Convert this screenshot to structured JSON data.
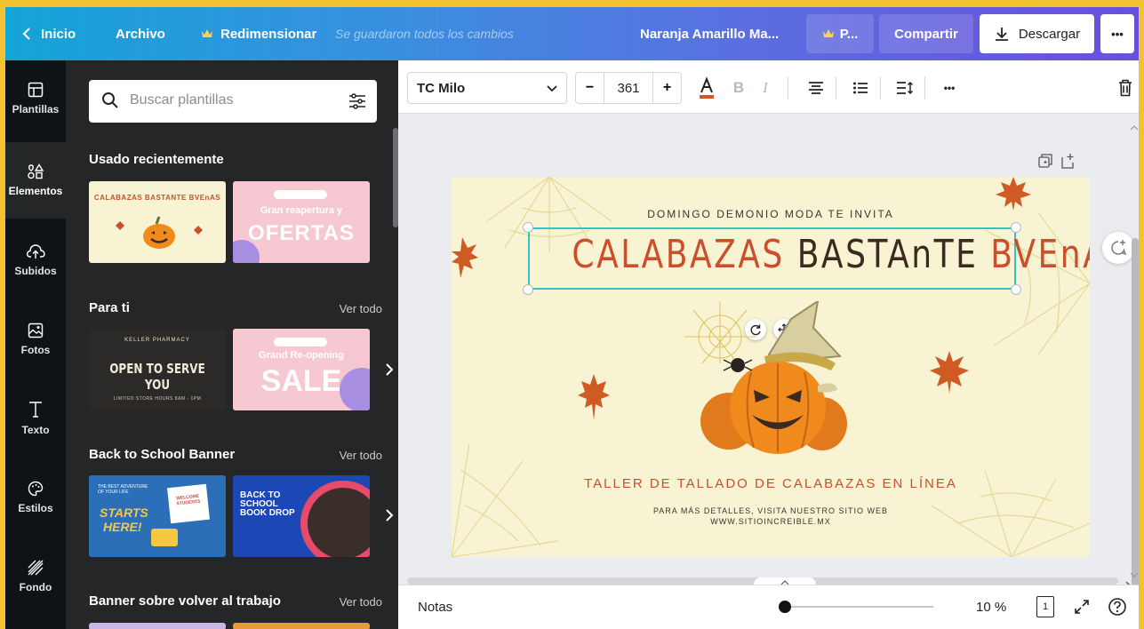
{
  "topbar": {
    "back_label": "Inicio",
    "file_label": "Archivo",
    "resize_label": "Redimensionar",
    "status_text": "Se guardaron todos los cambios",
    "doc_title": "Naranja Amarillo Ma...",
    "pro_label": "P...",
    "share_label": "Compartir",
    "download_label": "Descargar",
    "more_label": "•••"
  },
  "rail": {
    "items": [
      {
        "label": "Plantillas",
        "icon": "template-icon"
      },
      {
        "label": "Elementos",
        "icon": "elements-icon"
      },
      {
        "label": "Subidos",
        "icon": "upload-icon"
      },
      {
        "label": "Fotos",
        "icon": "photo-icon"
      },
      {
        "label": "Texto",
        "icon": "text-icon"
      },
      {
        "label": "Estilos",
        "icon": "palette-icon"
      },
      {
        "label": "Fondo",
        "icon": "background-icon"
      }
    ]
  },
  "panel": {
    "search_placeholder": "Buscar plantillas",
    "sections": [
      {
        "title": "Usado recientemente",
        "see_all": ""
      },
      {
        "title": "Para ti",
        "see_all": "Ver todo"
      },
      {
        "title": "Back to School Banner",
        "see_all": "Ver todo"
      },
      {
        "title": "Banner sobre volver al trabajo",
        "see_all": "Ver todo"
      }
    ],
    "thumbs": {
      "recent1_text": "CALABAZAS BASTANTE BVEnAS",
      "recent2_line1": "Gran reapertura y",
      "recent2_line2": "OFERTAS",
      "foryou1_top": "KELLER PHARMACY",
      "foryou1_main": "OPEN TO SERVE YOU",
      "foryou1_bottom": "LIMITED STORE HOURS 8AM - 1PM",
      "foryou2_line1": "Grand Re-opening",
      "foryou2_line2": "SALE",
      "school1_top": "THE BEST ADVENTURE OF YOUR LIFE",
      "school1_main1": "STARTS",
      "school1_main2": "HERE!",
      "school1_note1": "WELCOME",
      "school1_note2": "STUDENTS",
      "school2_main1": "BACK TO",
      "school2_main2": "SCHOOL",
      "school2_main3": "BOOK DROP"
    }
  },
  "toolbar": {
    "font_name": "TC Milo",
    "font_size": "361",
    "minus": "−",
    "plus": "+",
    "bold": "B",
    "italic": "I",
    "more": "•••"
  },
  "design": {
    "invite": "DOMINGO DEMONIO MODA TE INVITA",
    "title_part1": "CALABAZAS",
    "title_part2": "BASTAnTE",
    "title_part3": "BVEnAS",
    "subtitle": "TALLER DE TALLADO DE CALABAZAS EN LÍNEA",
    "details": "PARA MÁS DETALLES, VISITA NUESTRO SITIO WEB",
    "url": "WWW.SITIOINCREIBLE.MX"
  },
  "bottombar": {
    "notes_label": "Notas",
    "zoom": "10 %",
    "page_count": "1",
    "zoom_fraction": 0.0
  },
  "colors": {
    "title_orange": "#c9502a",
    "title_dark": "#3b2a20",
    "selection": "#2ec4c9",
    "cream": "#f8f3d3"
  }
}
